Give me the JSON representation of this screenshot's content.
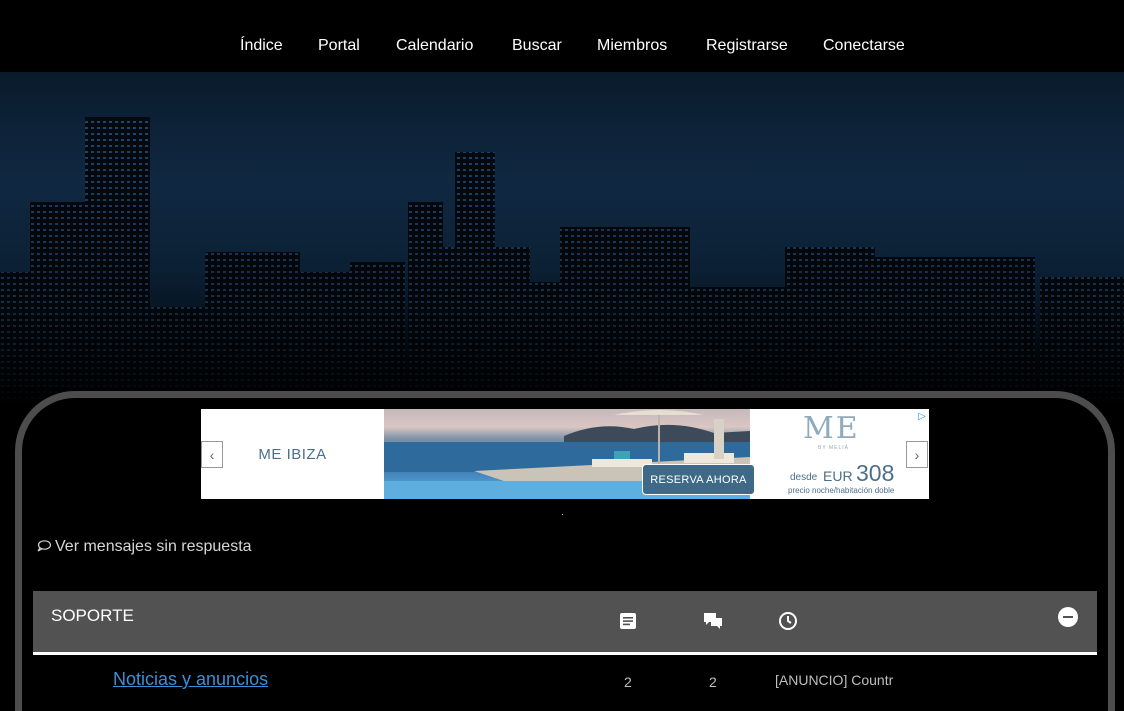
{
  "nav": {
    "items": [
      "Índice",
      "Portal",
      "Calendario",
      "Buscar",
      "Miembros",
      "Registrarse",
      "Conectarse"
    ]
  },
  "ad": {
    "brand": "ME IBIZA",
    "logo": "ME",
    "logo_sub": "BY MELIÁ",
    "cta": "RESERVA AHORA",
    "price_prefix": "desde",
    "currency": "EUR",
    "price": "308",
    "price_note": "precio noche/habitación doble",
    "prev_icon": "chevron-left-icon",
    "next_icon": "chevron-right-icon"
  },
  "links": {
    "unanswered": "Ver mensajes sin respuesta",
    "unanswered_icon": "speech-bubble-icon"
  },
  "category": {
    "title": "SOPORTE",
    "col_topics_icon": "document-icon",
    "col_posts_icon": "chat-bubbles-icon",
    "col_last_icon": "clock-icon",
    "collapse_icon": "minus-circle-icon"
  },
  "forums": [
    {
      "name": "Noticias y anuncios",
      "topics": "2",
      "posts": "2",
      "last_post": "[ANUNCIO] Countr"
    }
  ],
  "colors": {
    "nav_bg": "#000000",
    "category_bar": "#525252",
    "link_blue": "#3b8fd6",
    "container_border": "#4d4d4d"
  }
}
